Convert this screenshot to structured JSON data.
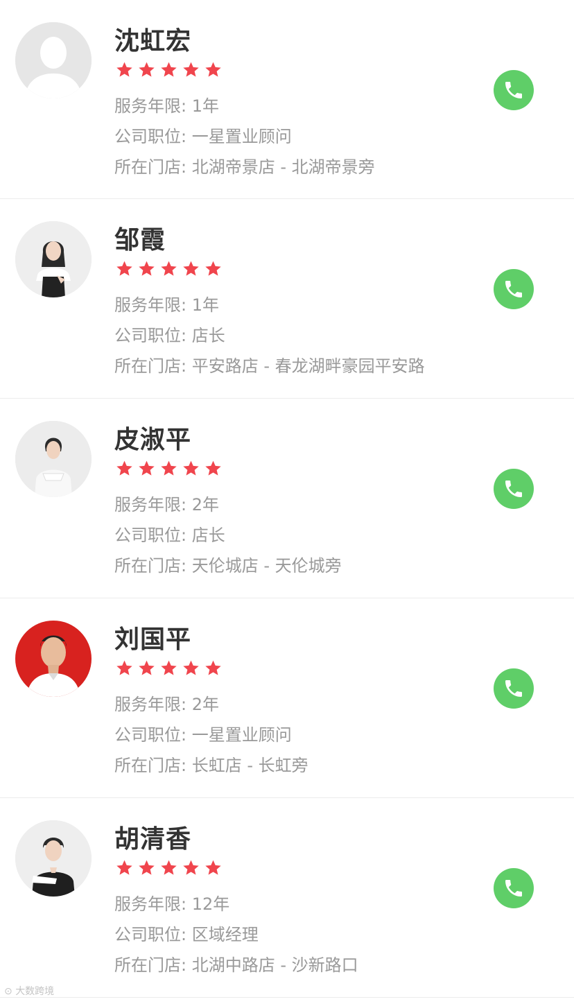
{
  "labels": {
    "years": "服务年限:",
    "position": "公司职位:",
    "store": "所在门店:"
  },
  "rating_max": 5,
  "colors": {
    "star": "#f0454d",
    "call_button": "#5fce68",
    "name_text": "#333333",
    "info_text": "#999999"
  },
  "agents": [
    {
      "name": "沈虹宏",
      "rating": 5,
      "years": "1年",
      "position": "一星置业顾问",
      "store": "北湖帝景店 - 北湖帝景旁",
      "avatar_icon": "default-user-avatar-icon"
    },
    {
      "name": "邹霞",
      "rating": 5,
      "years": "1年",
      "position": "店长",
      "store": "平安路店 - 春龙湖畔豪园平安路",
      "avatar_icon": "woman-portrait-photo"
    },
    {
      "name": "皮淑平",
      "rating": 5,
      "years": "2年",
      "position": "店长",
      "store": "天伦城店 - 天伦城旁",
      "avatar_icon": "woman-portrait-photo"
    },
    {
      "name": "刘国平",
      "rating": 5,
      "years": "2年",
      "position": "一星置业顾问",
      "store": "长虹店 - 长虹旁",
      "avatar_icon": "man-id-photo-red-background"
    },
    {
      "name": "胡清香",
      "rating": 5,
      "years": "12年",
      "position": "区域经理",
      "store": "北湖中路店 - 沙新路口",
      "avatar_icon": "woman-portrait-photo"
    }
  ],
  "watermark": "大数跨境"
}
